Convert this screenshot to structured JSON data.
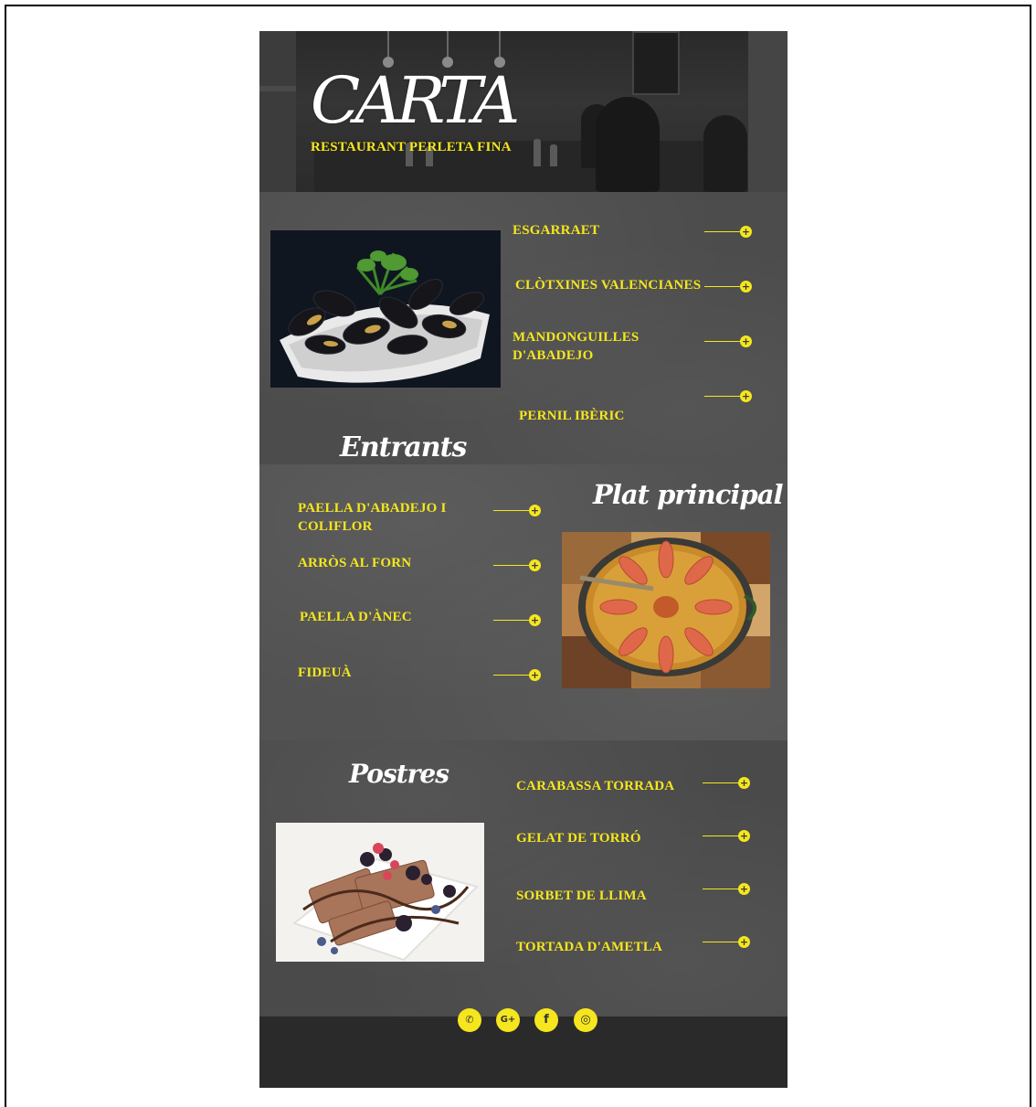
{
  "header": {
    "title": "CARTA",
    "restaurant": "RESTAURANT PERLETA FINA"
  },
  "entrants": {
    "title": "Entrants",
    "items": [
      "ESGARRAET",
      "CLÒTXINES VALENCIANES",
      "MANDONGUILLES D'ABADEJO",
      "PERNIL IBÈRIC"
    ]
  },
  "principal": {
    "title": "Plat principal",
    "items": [
      "PAELLA D'ABADEJO I COLIFLOR",
      "ARRÒS AL FORN",
      "PAELLA D'ÀNEC",
      "FIDEUÀ"
    ]
  },
  "postres": {
    "title": "Postres",
    "items": [
      "CARABASSA TORRADA",
      "GELAT DE TORRÓ",
      "SORBET DE LLIMA",
      "TORTADA D'AMETLA"
    ]
  },
  "footer": {
    "social": [
      {
        "icon": "whatsapp-icon",
        "glyph": "✆"
      },
      {
        "icon": "google-plus-icon",
        "glyph": "G+"
      },
      {
        "icon": "facebook-icon",
        "glyph": "f"
      },
      {
        "icon": "instagram-icon",
        "glyph": "◎"
      }
    ]
  },
  "colors": {
    "accent": "#f5e61e",
    "chalkboard": "#4c4c4c",
    "header_dark": "#2a2a2a"
  },
  "plus_glyph": "+"
}
